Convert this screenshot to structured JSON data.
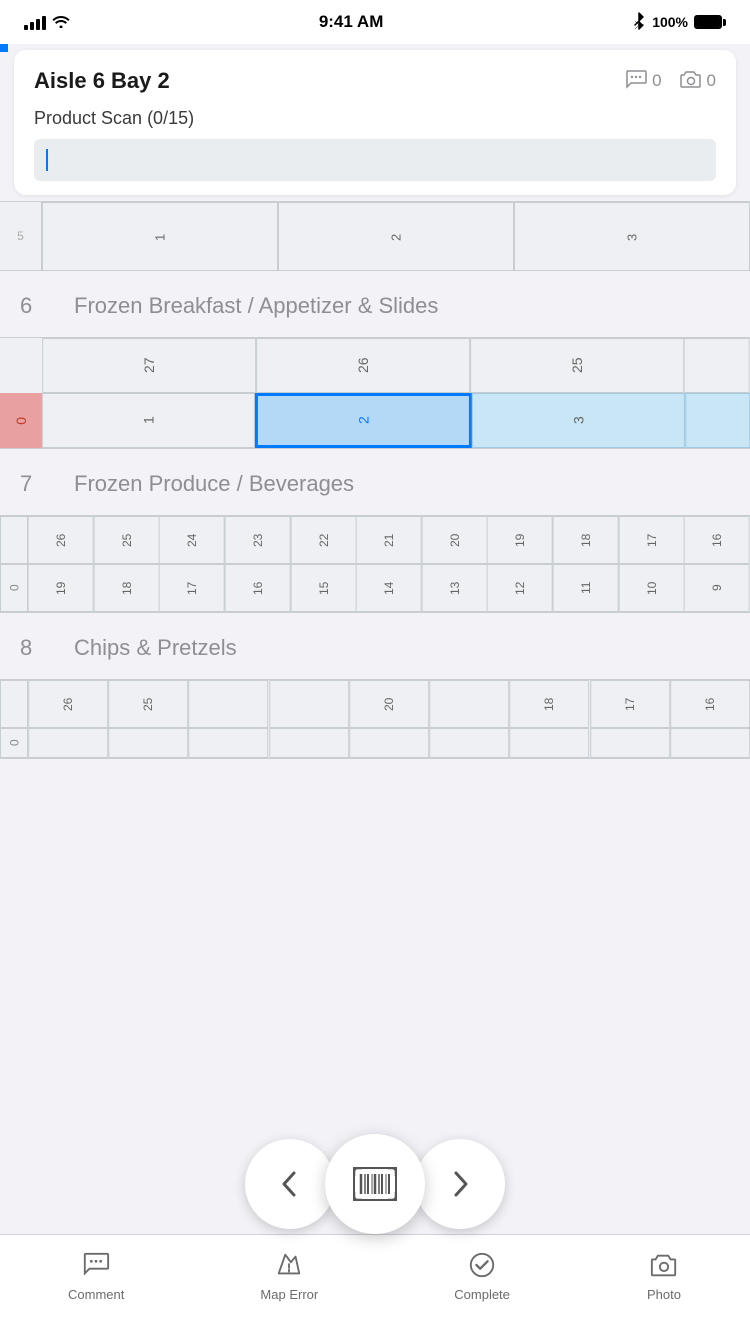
{
  "statusBar": {
    "time": "9:41 AM",
    "battery": "100%",
    "batteryFull": true
  },
  "header": {
    "title": "Aisle 6 Bay 2",
    "commentCount": "0",
    "photoCount": "0"
  },
  "productScan": {
    "label": "Product Scan (0/15)",
    "inputPlaceholder": ""
  },
  "aisles": [
    {
      "number": "6",
      "name": "Frozen Breakfast / Appetizer & Slides"
    },
    {
      "number": "7",
      "name": "Frozen Produce / Beverages"
    },
    {
      "number": "8",
      "name": "Chips & Pretzels"
    }
  ],
  "shelf6": {
    "topRow": [
      "27",
      "26",
      "25"
    ],
    "bottomRow": [
      "1",
      "2",
      "3"
    ],
    "activeCell": "2",
    "rowLabel": "0"
  },
  "shelf7": {
    "topNumbers": [
      "26",
      "25",
      "24",
      "23",
      "22",
      "21",
      "20",
      "19",
      "18",
      "17",
      "16"
    ],
    "bottomNumbers": [
      "19",
      "18",
      "17",
      "16",
      "15",
      "14",
      "13",
      "12",
      "11",
      "10",
      "9"
    ],
    "rowLabel": "0"
  },
  "shelf8": {
    "topNumbers": [
      "26",
      "25",
      "",
      "",
      "20",
      "",
      "18",
      "17",
      "16"
    ],
    "bottomNumbers": [
      "",
      "",
      "",
      "",
      "",
      "",
      "",
      "",
      ""
    ],
    "rowLabel": "0"
  },
  "tabBar": {
    "items": [
      {
        "id": "comment",
        "label": "Comment"
      },
      {
        "id": "map-error",
        "label": "Map Error"
      },
      {
        "id": "complete",
        "label": "Complete"
      },
      {
        "id": "photo",
        "label": "Photo"
      }
    ]
  },
  "partialGrid": {
    "cells": [
      "1",
      "2",
      "3"
    ]
  },
  "colors": {
    "blue": "#007AFF",
    "lightBlue": "#c8e6f5",
    "activeBlue": "#b3d9f7",
    "rowLabel": "#e8a0a0",
    "grayBg": "#eef0f3",
    "borderGray": "#c8cdd2"
  }
}
